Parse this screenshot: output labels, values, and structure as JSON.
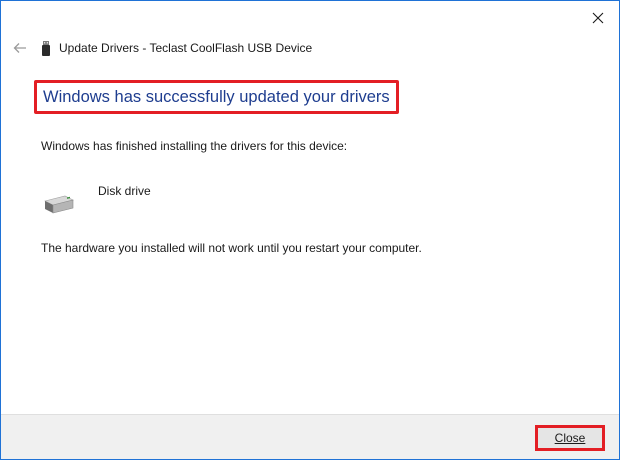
{
  "window": {
    "title": "Update Drivers - Teclast CoolFlash USB Device",
    "accent_color": "#1f72d6"
  },
  "content": {
    "headline": "Windows has successfully updated your drivers",
    "headline_color": "#1e3d8f",
    "finished_text": "Windows has finished installing the drivers for this device:",
    "device": {
      "name": "Disk drive",
      "icon": "disk-drive-icon"
    },
    "restart_text": "The hardware you installed will not work until you restart your computer."
  },
  "footer": {
    "close_label": "Close"
  },
  "highlight_color": "#e31e24"
}
